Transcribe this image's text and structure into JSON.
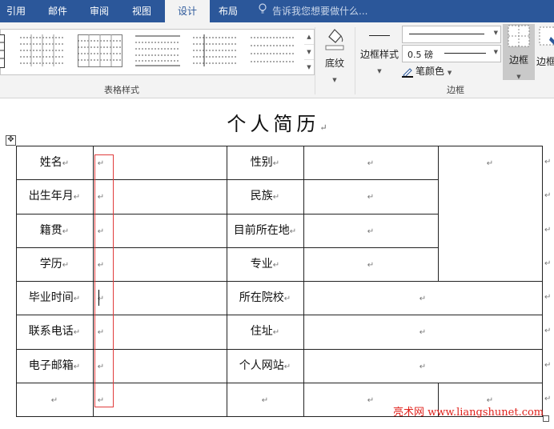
{
  "ribbon": {
    "tabs": [
      {
        "label": "引用"
      },
      {
        "label": "邮件"
      },
      {
        "label": "审阅"
      },
      {
        "label": "视图"
      },
      {
        "label": "设计"
      },
      {
        "label": "布局"
      }
    ],
    "active_tab": "设计",
    "tell_me_placeholder": "告诉我您想要做什么...",
    "table_styles_group_label": "表格样式",
    "shading_label": "底纹",
    "border_styles_label": "边框样式",
    "pen_weight_value": "0.5 磅",
    "pen_color_label": "笔颜色",
    "borders_label": "边框",
    "borders_group_label": "边框",
    "border_painter_label": "边框刷"
  },
  "document": {
    "title": "个人简历",
    "table": {
      "left_labels": [
        "姓名",
        "出生年月",
        "籍贯",
        "学历",
        "毕业时间",
        "联系电话",
        "电子邮箱",
        ""
      ],
      "right_labels": [
        "性别",
        "民族",
        "目前所在地",
        "专业",
        "所在院校",
        "住址",
        "个人网站",
        ""
      ]
    }
  },
  "watermark": "亮术网 www.liangshunet.com",
  "colors": {
    "tab_bar": "#2b579a",
    "ribbon_bg": "#f3f3f3",
    "highlight_box": "#e03c3c",
    "watermark": "#e0221c"
  }
}
